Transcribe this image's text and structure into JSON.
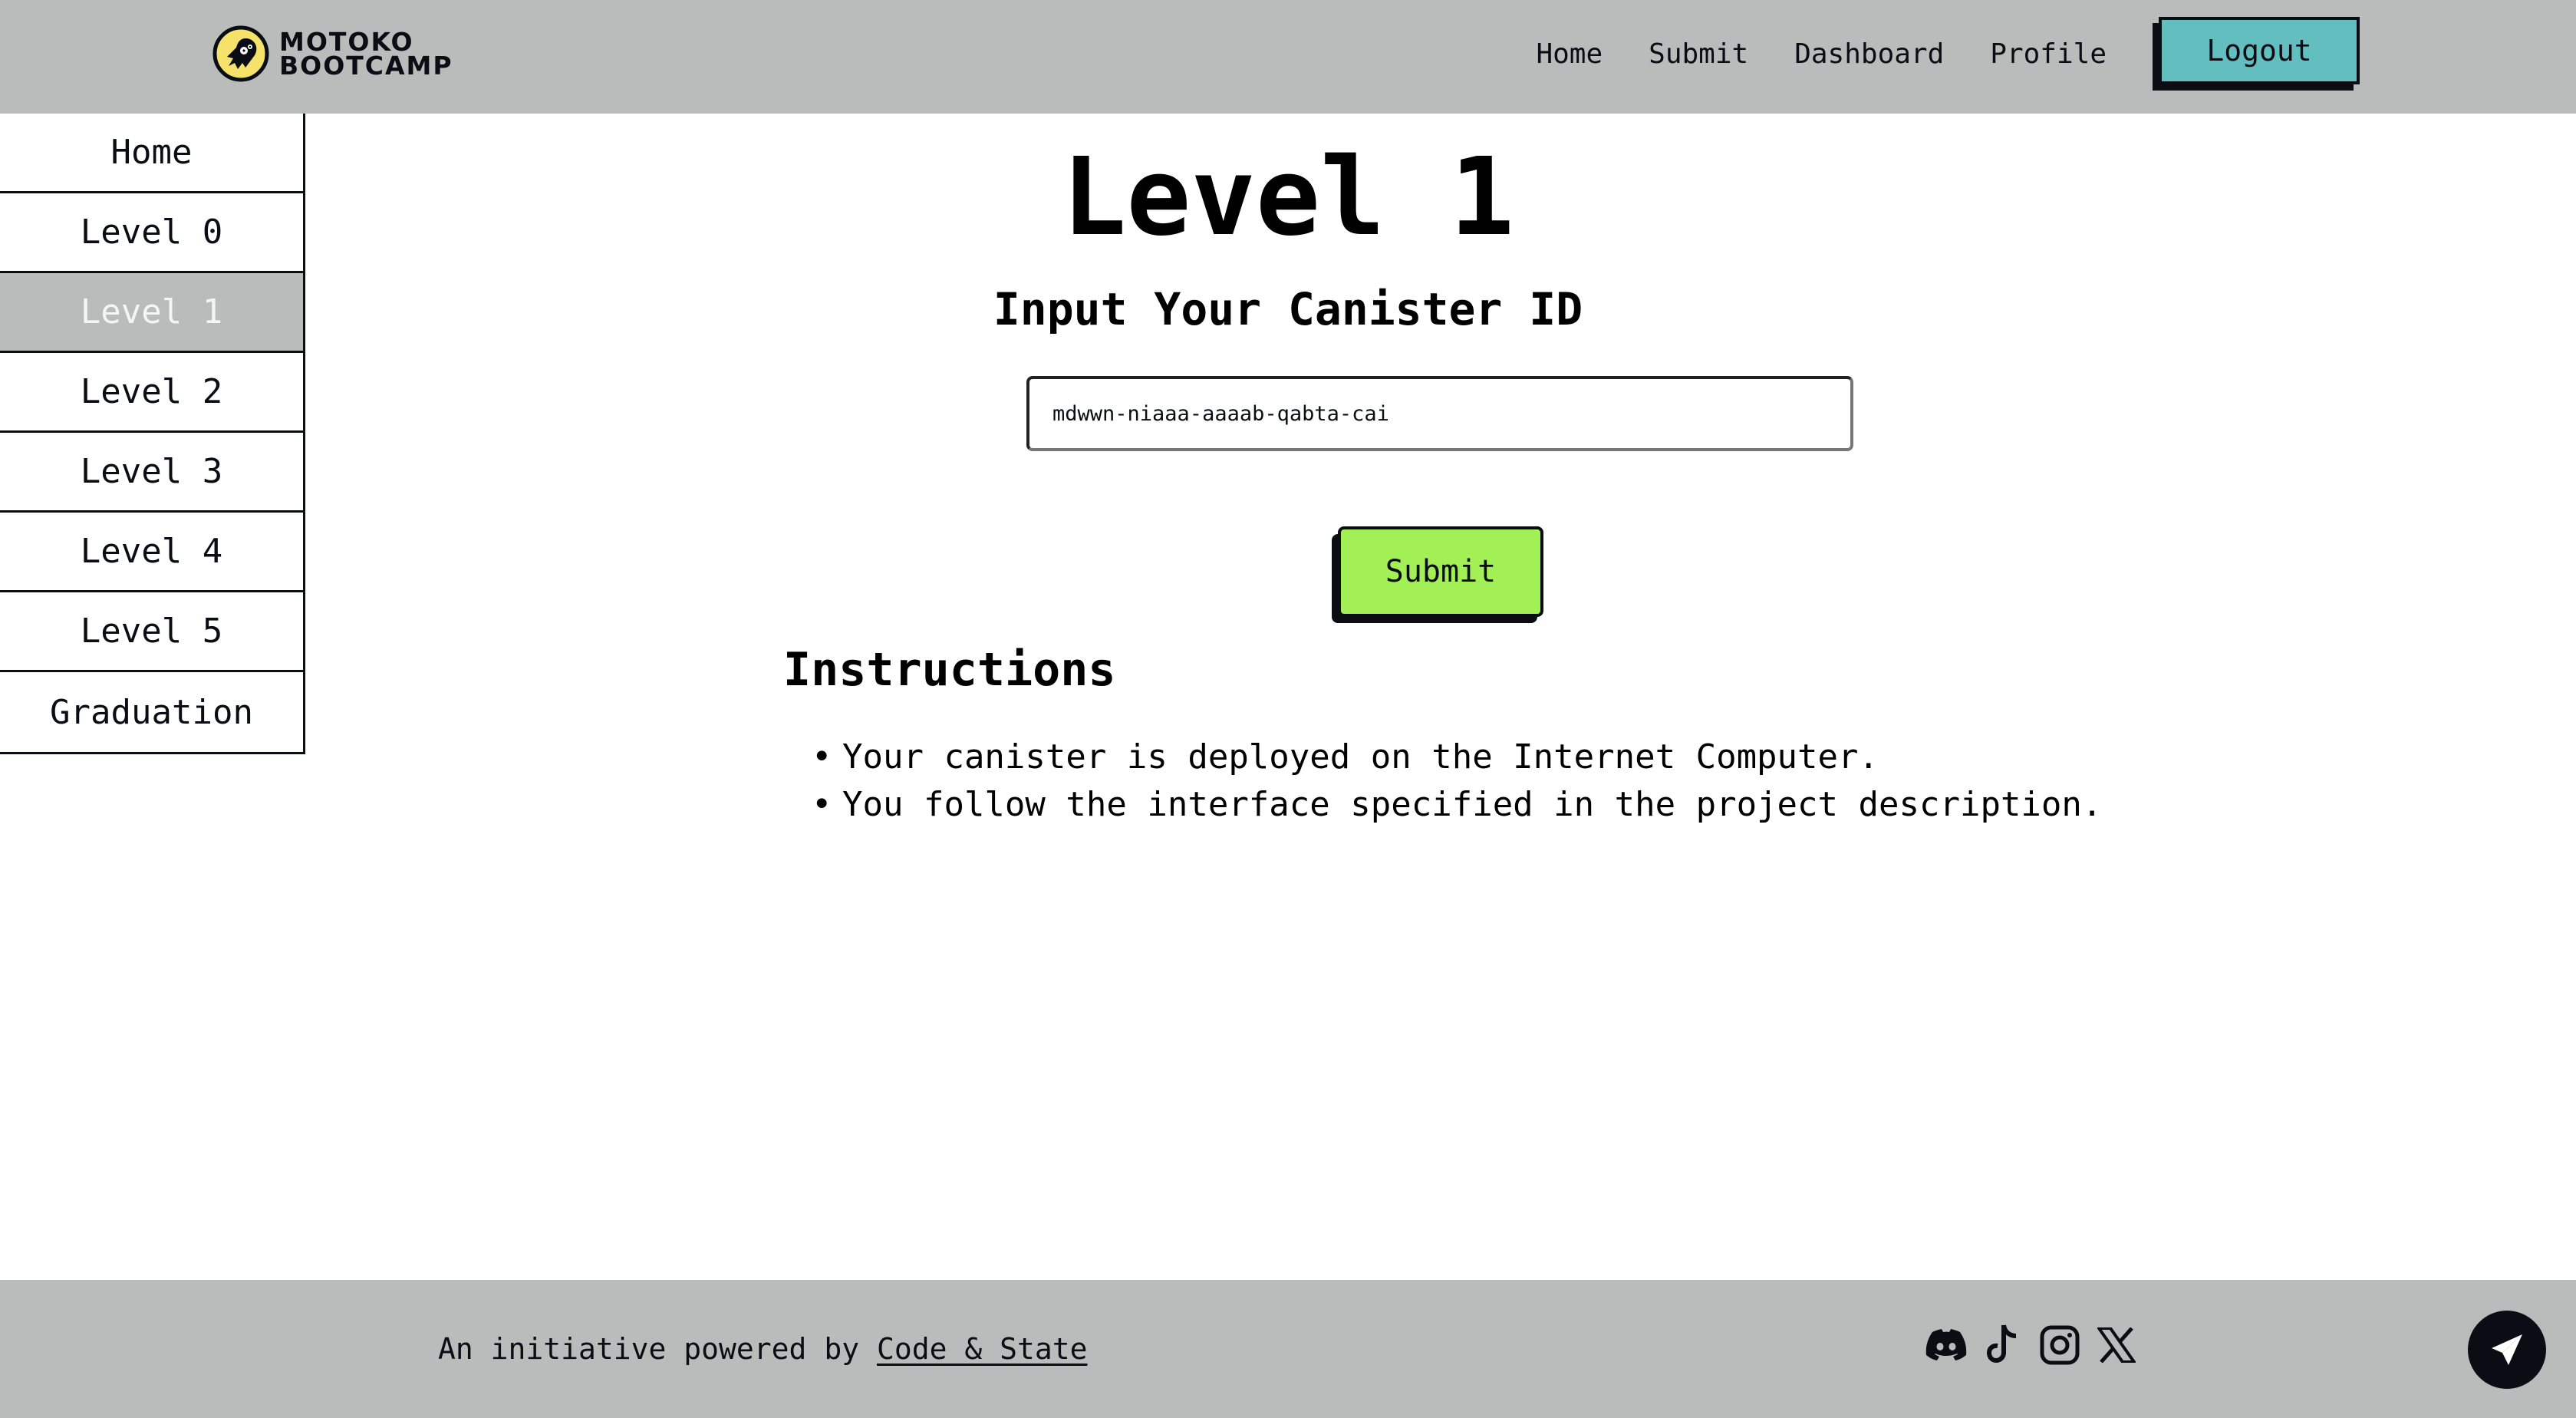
{
  "brand": {
    "name_line1": "MOTOKO",
    "name_line2": "BOOTCAMP",
    "logo_icon": "ghost-logo-icon",
    "logo_color": "#f5e26b"
  },
  "nav": {
    "links": [
      {
        "label": "Home"
      },
      {
        "label": "Submit"
      },
      {
        "label": "Dashboard"
      },
      {
        "label": "Profile"
      }
    ],
    "logout_label": "Logout",
    "logout_color": "#63bfbf"
  },
  "sidebar": {
    "items": [
      {
        "label": "Home",
        "active": false
      },
      {
        "label": "Level 0",
        "active": false
      },
      {
        "label": "Level 1",
        "active": true
      },
      {
        "label": "Level 2",
        "active": false
      },
      {
        "label": "Level 3",
        "active": false
      },
      {
        "label": "Level 4",
        "active": false
      },
      {
        "label": "Level 5",
        "active": false
      },
      {
        "label": "Graduation",
        "active": false
      }
    ]
  },
  "main": {
    "title": "Level 1",
    "subtitle": "Input Your Canister ID",
    "canister_input": {
      "value": "mdwwn-niaaa-aaaab-qabta-cai",
      "placeholder": ""
    },
    "submit_label": "Submit",
    "submit_color": "#a2ef56",
    "instructions": {
      "heading": "Instructions",
      "bullet_glyph": "•",
      "items": [
        "Your canister is deployed on the Internet Computer.",
        "You follow the interface specified in the project description."
      ]
    }
  },
  "footer": {
    "prefix": "An initiative powered by ",
    "link_label": "Code & State",
    "socials": [
      {
        "icon": "discord-icon"
      },
      {
        "icon": "tiktok-icon"
      },
      {
        "icon": "instagram-icon"
      },
      {
        "icon": "x-icon"
      }
    ],
    "fab_icon": "send-icon"
  }
}
